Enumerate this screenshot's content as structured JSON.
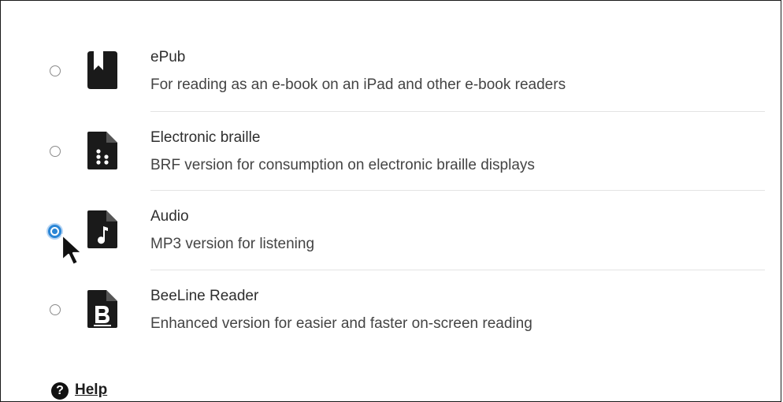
{
  "formats": [
    {
      "id": "epub",
      "icon": "bookmark-book-icon",
      "title": "ePub",
      "description": "For reading as an e-book on an iPad and other e-book readers",
      "selected": false
    },
    {
      "id": "braille",
      "icon": "braille-file-icon",
      "title": "Electronic braille",
      "description": "BRF version for consumption on electronic braille displays",
      "selected": false
    },
    {
      "id": "audio",
      "icon": "audio-file-icon",
      "title": "Audio",
      "description": "MP3 version for listening",
      "selected": true
    },
    {
      "id": "beeline",
      "icon": "beeline-file-icon",
      "title": "BeeLine Reader",
      "description": "Enhanced version for easier and faster on-screen reading",
      "selected": false
    }
  ],
  "help": {
    "icon": "question-circle-icon",
    "icon_glyph": "?",
    "label": "Help"
  },
  "colors": {
    "radio_selected": "#2a86d6",
    "icon_fill": "#1a1a1a",
    "separator": "#e3e3e3"
  }
}
